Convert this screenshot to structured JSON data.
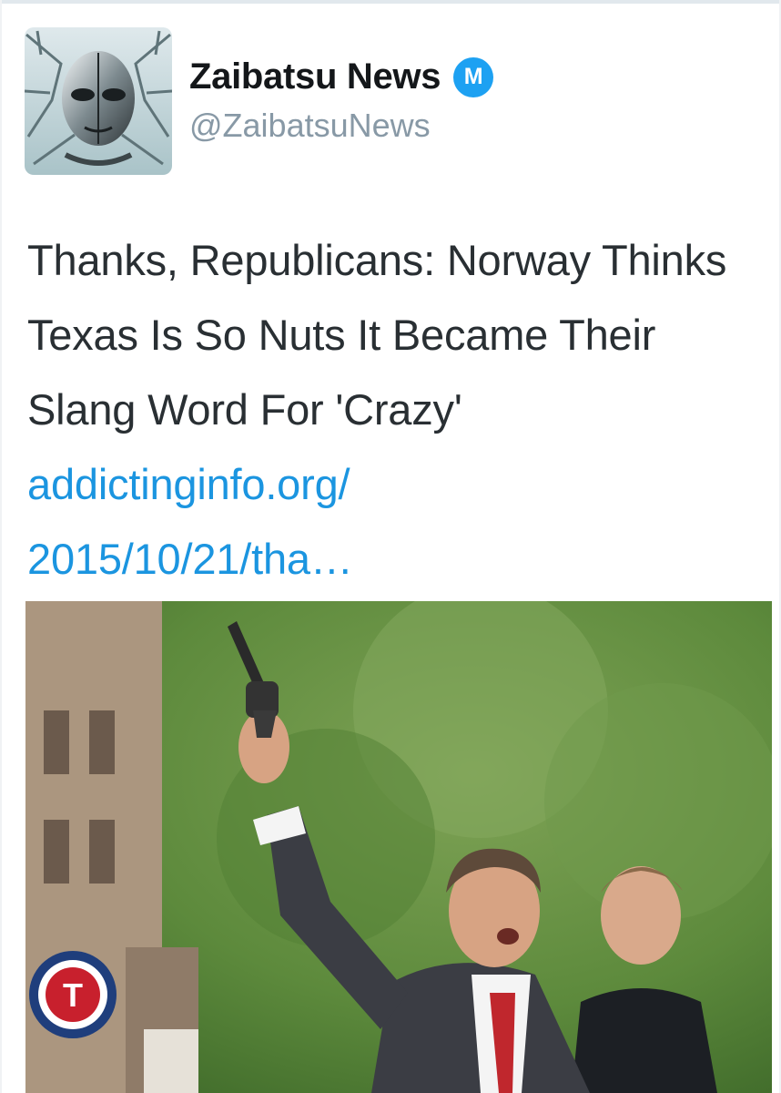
{
  "account": {
    "display_name": "Zaibatsu News",
    "handle": "@ZaibatsuNews",
    "badge_letter": "M",
    "avatar_icon": "robot-face-avatar",
    "badge_color": "#1da1f2"
  },
  "tweet": {
    "text": "Thanks, Republicans: Norway Thinks Texas Is So Nuts It Became Their Slang Word For 'Crazy' ",
    "link_line_1": "addictinginfo.org/",
    "link_line_2": "2015/10/21/tha…",
    "link_color": "#1b95e0"
  },
  "media": {
    "photo_icon": "photo-man-raising-revolver-at-parade",
    "sign_letter": "T"
  }
}
